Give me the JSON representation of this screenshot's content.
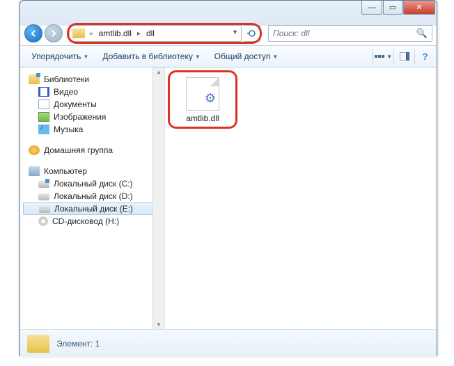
{
  "titlebar": {
    "min": "—",
    "max": "▭",
    "close": "✕"
  },
  "nav": {
    "breadcrumb": {
      "double_chevron": "«",
      "seg1": "amtlib.dll",
      "seg2": "dll"
    },
    "search_placeholder": "Поиск: dll"
  },
  "toolbar": {
    "organize": "Упорядочить",
    "add_library": "Добавить в библиотеку",
    "share": "Общий доступ"
  },
  "tree": {
    "libraries": "Библиотеки",
    "video": "Видео",
    "documents": "Документы",
    "images": "Изображения",
    "music": "Музыка",
    "homegroup": "Домашняя группа",
    "computer": "Компьютер",
    "disk_c": "Локальный диск (C:)",
    "disk_d": "Локальный диск (D:)",
    "disk_e": "Локальный диск (E:)",
    "cd": "CD-дисковод (H:)"
  },
  "content": {
    "file1_name": "amtlib.dll"
  },
  "status": {
    "count_label": "Элемент: 1"
  }
}
